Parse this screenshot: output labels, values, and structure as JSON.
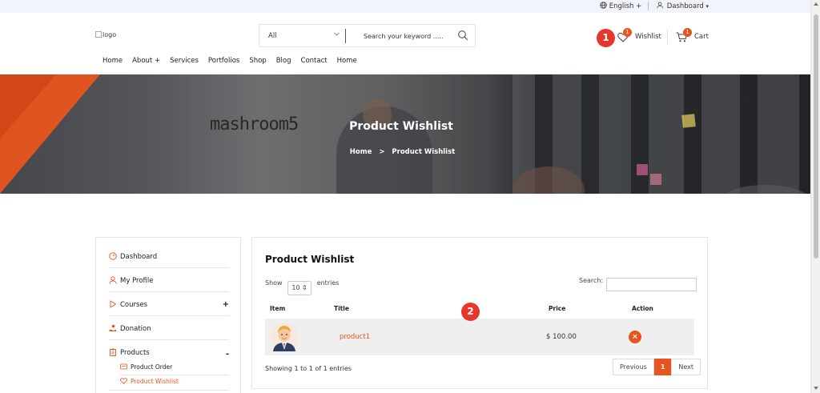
{
  "topbar": {
    "language": "English",
    "language_toggle": "+",
    "dashboard": "Dashboard",
    "dashboard_chevron": "▾"
  },
  "header": {
    "logo_alt": "logo",
    "search": {
      "category": "All",
      "placeholder": "Search your keyword ....."
    },
    "wishlist": {
      "label": "Wishlist",
      "count": "1"
    },
    "cart": {
      "label": "Cart",
      "count": "1"
    }
  },
  "annotations": {
    "callout_1": "1",
    "callout_2": "2"
  },
  "nav": {
    "items": [
      "Home",
      "About +",
      "Services",
      "Portfolios",
      "Shop",
      "Blog",
      "Contact",
      "Home"
    ]
  },
  "hero": {
    "wall_text": "mashroom5",
    "title": "Product Wishlist",
    "breadcrumb_home": "Home",
    "breadcrumb_sep": ">",
    "breadcrumb_current": "Product Wishlist"
  },
  "sidebar": {
    "items": [
      {
        "label": "Dashboard"
      },
      {
        "label": "My Profile"
      },
      {
        "label": "Courses",
        "toggle": "+"
      },
      {
        "label": "Donation"
      },
      {
        "label": "Products",
        "toggle": "-"
      }
    ],
    "sub_items": [
      {
        "label": "Product Order"
      },
      {
        "label": "Product Wishlist"
      }
    ]
  },
  "table_panel": {
    "title": "Product Wishlist",
    "show_label": "Show",
    "entries_value": "10 ⇕",
    "entries_label": "entries",
    "search_label": "Search:",
    "columns": [
      "Item",
      "Title",
      "Price",
      "Action"
    ],
    "rows": [
      {
        "title": "product1",
        "price": "$ 100.00",
        "action": "×"
      }
    ],
    "info": "Showing 1 to 1 of 1 entries",
    "pager": {
      "previous": "Previous",
      "current": "1",
      "next": "Next"
    }
  },
  "colors": {
    "accent": "#e8541d",
    "callout": "#e7372d",
    "topbar_bg": "#f1f5fb"
  }
}
